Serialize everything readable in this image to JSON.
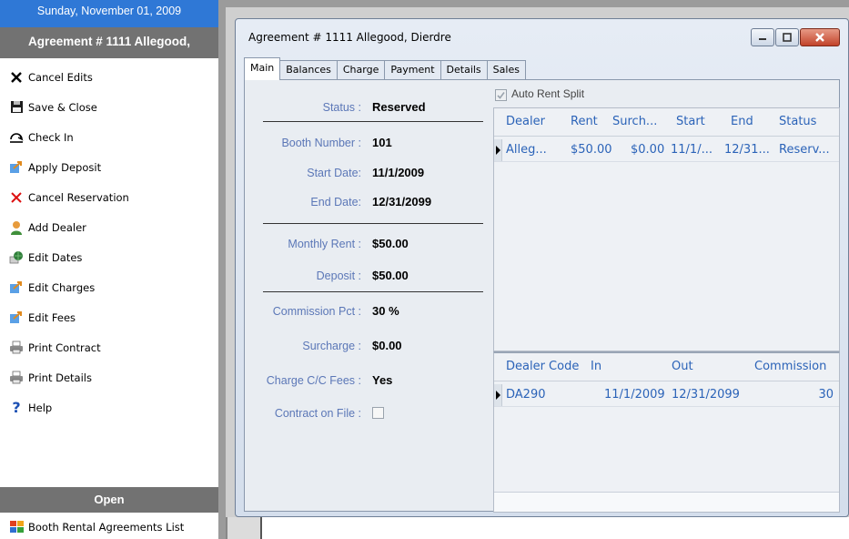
{
  "sidebar": {
    "date": "Sunday, November 01, 2009",
    "agreement_title": "Agreement # 1111 Allegood,",
    "items": [
      {
        "label": "Cancel Edits",
        "icon": "x-icon"
      },
      {
        "label": "Save & Close",
        "icon": "floppy-disk-icon"
      },
      {
        "label": "Check In",
        "icon": "check-in-icon"
      },
      {
        "label": "Apply Deposit",
        "icon": "arrow-box-icon"
      },
      {
        "label": "Cancel Reservation",
        "icon": "red-x-icon"
      },
      {
        "label": "Add Dealer",
        "icon": "person-icon"
      },
      {
        "label": "Edit Dates",
        "icon": "globe-edit-icon"
      },
      {
        "label": "Edit Charges",
        "icon": "arrow-box-icon"
      },
      {
        "label": "Edit Fees",
        "icon": "arrow-box-icon"
      },
      {
        "label": "Print Contract",
        "icon": "printer-icon"
      },
      {
        "label": "Print Details",
        "icon": "printer-icon"
      },
      {
        "label": "Help",
        "icon": "question-mark-icon"
      }
    ],
    "open_section": "Open",
    "list_link": "Booth Rental Agreements List"
  },
  "dialog": {
    "title": "Agreement # 1111 Allegood, Dierdre",
    "tabs": [
      "Main",
      "Balances",
      "Charge",
      "Payment",
      "Details",
      "Sales"
    ],
    "active_tab": "Main"
  },
  "form": {
    "status_label": "Status :",
    "status_value": "Reserved",
    "booth_label": "Booth Number :",
    "booth_value": "101",
    "start_label": "Start Date:",
    "start_value": "11/1/2009",
    "end_label": "End Date:",
    "end_value": "12/31/2099",
    "rent_label": "Monthly Rent :",
    "rent_value": "$50.00",
    "deposit_label": "Deposit :",
    "deposit_value": "$50.00",
    "commission_label": "Commission Pct :",
    "commission_value": "30 %",
    "surcharge_label": "Surcharge :",
    "surcharge_value": "$0.00",
    "ccfees_label": "Charge C/C Fees :",
    "ccfees_value": "Yes",
    "contract_label": "Contract on File :",
    "contract_checked": false
  },
  "auto_rent_split": {
    "label": "Auto Rent Split",
    "checked": true
  },
  "dealer_grid": {
    "headers": [
      "Dealer",
      "Rent",
      "Surch...",
      "Start",
      "End",
      "Status"
    ],
    "rows": [
      [
        "Alleg...",
        "$50.00",
        "$0.00",
        "11/1/...",
        "12/31...",
        "Reserv..."
      ]
    ]
  },
  "booth_grid": {
    "headers": [
      "Dealer Code",
      "In",
      "Out",
      "Commission"
    ],
    "rows": [
      [
        "DA290",
        "11/1/2009",
        "12/31/2099",
        "30"
      ]
    ]
  },
  "colors": {
    "date_bar": "#2f78d6",
    "section_bar": "#727272",
    "label_blue": "#5b77b7",
    "grid_text": "#2b63b8"
  }
}
